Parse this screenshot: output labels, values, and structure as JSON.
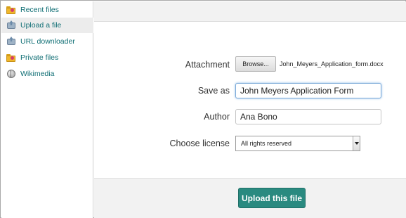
{
  "sidebar": {
    "items": [
      {
        "label": "Recent files",
        "icon": "folder-icon",
        "active": false
      },
      {
        "label": "Upload a file",
        "icon": "upload-icon",
        "active": true
      },
      {
        "label": "URL downloader",
        "icon": "upload-icon",
        "active": false
      },
      {
        "label": "Private files",
        "icon": "folder-icon",
        "active": false
      },
      {
        "label": "Wikimedia",
        "icon": "globe-icon",
        "active": false
      }
    ]
  },
  "form": {
    "attachment_label": "Attachment",
    "browse_label": "Browse...",
    "attachment_filename": "John_Meyers_Application_form.docx",
    "save_as_label": "Save as",
    "save_as_value": "John Meyers Application Form",
    "author_label": "Author",
    "author_value": "Ana Bono",
    "license_label": "Choose license",
    "license_value": "All rights reserved"
  },
  "footer": {
    "upload_label": "Upload this file"
  },
  "colors": {
    "link": "#0f6e74",
    "primary_button": "#2a8a80",
    "active_item_bg": "#ececec"
  }
}
